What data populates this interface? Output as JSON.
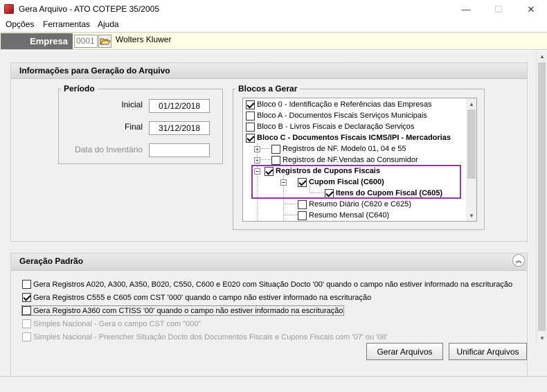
{
  "window": {
    "title": "Gera Arquivo - ATO COTEPE 35/2005",
    "minimize": "—",
    "maximize": "☐",
    "close": "✕"
  },
  "menu": [
    "Opções",
    "Ferramentas",
    "Ajuda"
  ],
  "empresa": {
    "label": "Empresa",
    "code": "0001",
    "name": "Wolters Kluwer"
  },
  "info_panel": {
    "title": "Informações para Geração do Arquivo",
    "periodo": {
      "title": "Período",
      "inicial_label": "Inicial",
      "inicial_value": "01/12/2018",
      "final_label": "Final",
      "final_value": "31/12/2018",
      "inventario_label": "Data do Inventário",
      "inventario_value": ""
    },
    "blocos": {
      "title": "Blocos a Gerar",
      "items": [
        {
          "label": "Bloco 0 - Identificação e Referências das Empresas",
          "checked": true
        },
        {
          "label": "Bloco A - Documentos Fiscais Serviços Municipais",
          "checked": false
        },
        {
          "label": "Bloco B - Livros Fiscais e Declaração Serviços",
          "checked": false
        },
        {
          "label": "Bloco C - Documentos Fiscais ICMS/IPI - Mercadorias",
          "checked": true
        },
        {
          "label": "Registros de NF. Modelo 01, 04 e 55",
          "checked": false
        },
        {
          "label": "Registros de NF.Vendas ao Consumidor",
          "checked": false
        },
        {
          "label": "Registros de Cupons Fiscais",
          "checked": true
        },
        {
          "label": "Cupom Fiscal  (C600)",
          "checked": true
        },
        {
          "label": "Itens do Cupom Fiscal  (C605)",
          "checked": true
        },
        {
          "label": "Resumo Diário  (C620 e C625)",
          "checked": false
        },
        {
          "label": "Resumo Mensal  (C640)",
          "checked": false
        }
      ]
    }
  },
  "geracao_panel": {
    "title": "Geração Padrão",
    "collapse_icon": "chevron-double-up-icon",
    "options": [
      {
        "label": "Gera Registros A020, A300, A350, B020, C550, C600 e E020 com Situação Docto '00' quando o campo não estiver informado na escrituração",
        "checked": false,
        "enabled": true
      },
      {
        "label": "Gera Registros C555 e C605 com CST '000' quando o campo não estiver informado na escrituração",
        "checked": true,
        "enabled": true
      },
      {
        "label": "Gera Registro A360 com CTISS '00' quando o campo não estiver informado na escrituração",
        "checked": false,
        "enabled": true
      },
      {
        "label": "Simples Nacional - Gera o campo CST com \"000\"",
        "checked": false,
        "enabled": false
      },
      {
        "label": "Simples Nacional - Preencher Situação Docto dos Documentos Fiscais e Cupons Fiscais com '07' ou '08'",
        "checked": false,
        "enabled": false
      }
    ]
  },
  "buttons": {
    "gerar": "Gerar Arquivos",
    "unificar": "Unificar Arquivos"
  }
}
